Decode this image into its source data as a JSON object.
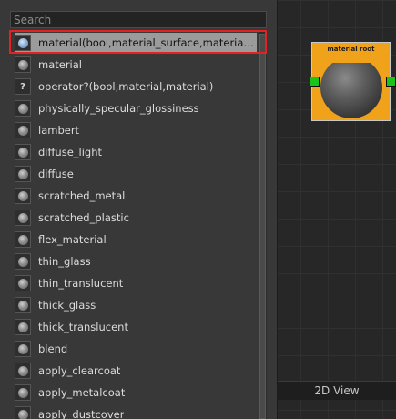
{
  "search": {
    "placeholder": "Search",
    "value": ""
  },
  "list": {
    "items": [
      {
        "label": "material(bool,material_surface,material_su...",
        "icon": "sphere-icon",
        "selected": true
      },
      {
        "label": "material",
        "icon": "sphere-icon"
      },
      {
        "label": "operator?(bool,material,material)",
        "icon": "question-icon",
        "glyph": "?"
      },
      {
        "label": "physically_specular_glossiness",
        "icon": "sphere-icon"
      },
      {
        "label": "lambert",
        "icon": "sphere-icon"
      },
      {
        "label": "diffuse_light",
        "icon": "sphere-icon"
      },
      {
        "label": "diffuse",
        "icon": "sphere-icon"
      },
      {
        "label": "scratched_metal",
        "icon": "sphere-icon"
      },
      {
        "label": "scratched_plastic",
        "icon": "sphere-icon"
      },
      {
        "label": "flex_material",
        "icon": "sphere-icon"
      },
      {
        "label": "thin_glass",
        "icon": "sphere-icon"
      },
      {
        "label": "thin_translucent",
        "icon": "sphere-icon"
      },
      {
        "label": "thick_glass",
        "icon": "sphere-icon"
      },
      {
        "label": "thick_translucent",
        "icon": "sphere-icon"
      },
      {
        "label": "blend",
        "icon": "sphere-icon"
      },
      {
        "label": "apply_clearcoat",
        "icon": "sphere-icon"
      },
      {
        "label": "apply_metalcoat",
        "icon": "sphere-icon"
      },
      {
        "label": "apply_dustcover",
        "icon": "sphere-icon"
      }
    ]
  },
  "node": {
    "title": "material root"
  },
  "view_tab": {
    "label": "2D View"
  },
  "colors": {
    "selection_outline": "#e52222",
    "node_header": "#f0a21b",
    "port": "#19c419"
  }
}
